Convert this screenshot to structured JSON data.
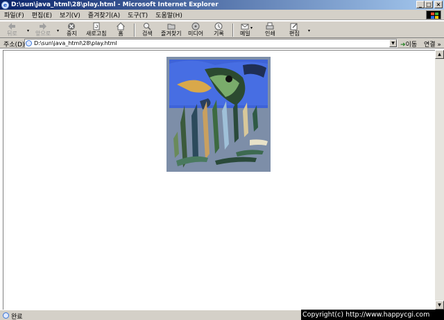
{
  "window": {
    "title": "D:\\sun\\java_html\\28\\play.html - Microsoft Internet Explorer",
    "minimize": "_",
    "maximize": "□",
    "close": "×"
  },
  "menu": [
    "파일(F)",
    "편집(E)",
    "보기(V)",
    "즐겨찾기(A)",
    "도구(T)",
    "도움말(H)"
  ],
  "toolbar": {
    "back": "뒤로",
    "forward": "앞으로",
    "stop": "중지",
    "refresh": "새로고침",
    "home": "홈",
    "search": "검색",
    "favorites": "즐겨찾기",
    "media": "미디어",
    "history": "기록",
    "mail": "메일",
    "print": "인쇄",
    "edit": "편집"
  },
  "address": {
    "label": "주소(D)",
    "value": "D:\\sun\\java_html\\28\\play.html",
    "go": "이동",
    "links": "연결 »"
  },
  "status": {
    "text": "완료",
    "copyright": "Copyright(c) http://www.happycgi.com"
  }
}
